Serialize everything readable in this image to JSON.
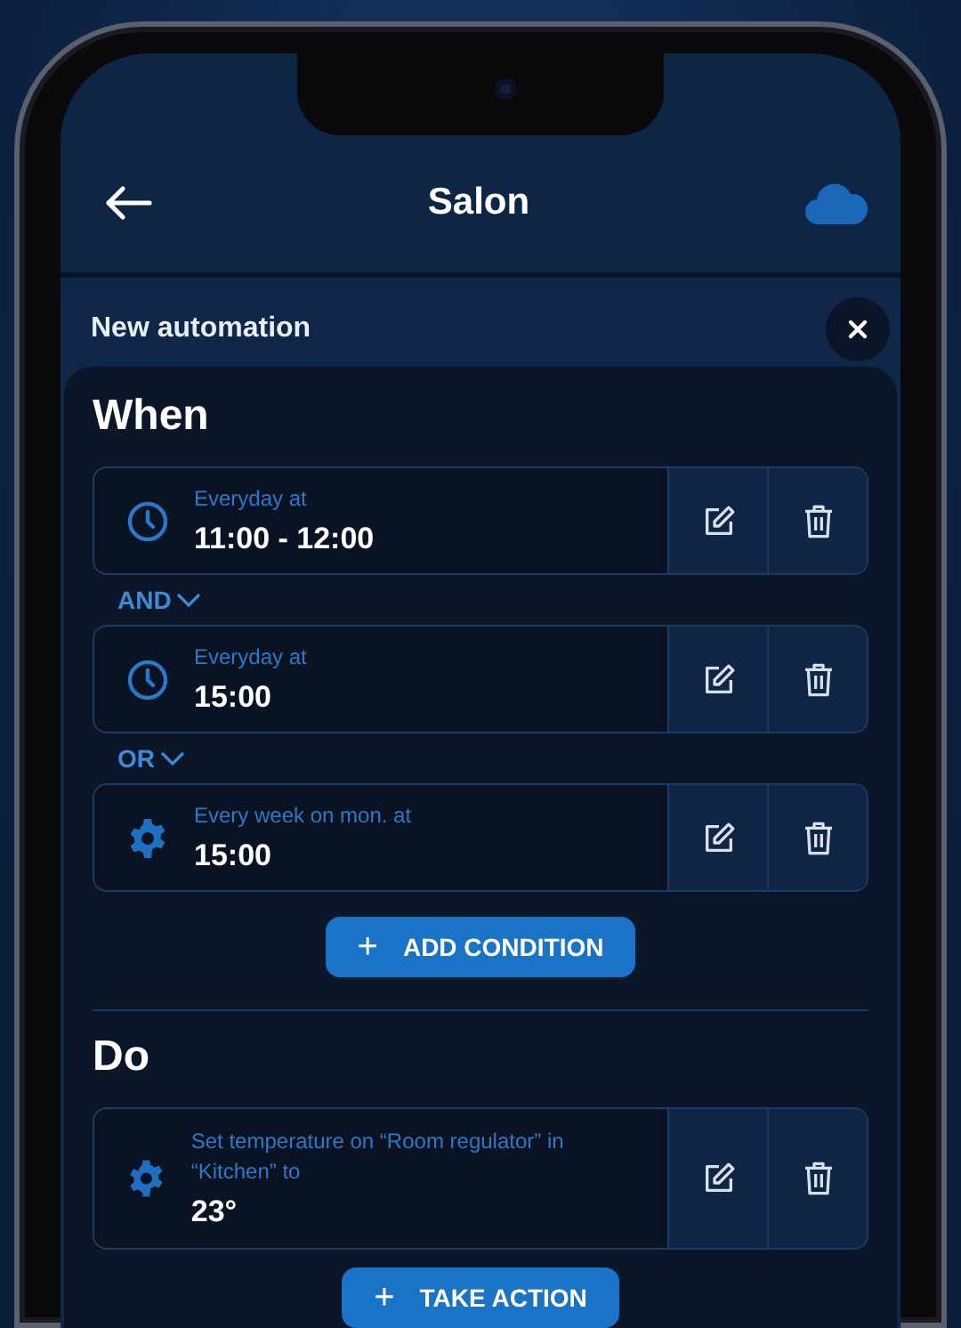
{
  "header": {
    "title": "Salon"
  },
  "dialog": {
    "title": "New automation"
  },
  "when": {
    "heading": "When",
    "items": [
      {
        "kind": "time",
        "caption": "Everyday at",
        "value": "11:00 - 12:00"
      },
      {
        "kind": "connector",
        "label": "AND"
      },
      {
        "kind": "time",
        "caption": "Everyday at",
        "value": "15:00"
      },
      {
        "kind": "connector",
        "label": "OR"
      },
      {
        "kind": "schedule",
        "caption": "Every week on mon. at",
        "value": "15:00"
      }
    ],
    "button": "ADD CONDITION",
    "button_icon": "+"
  },
  "do": {
    "heading": "Do",
    "items": [
      {
        "kind": "schedule",
        "caption": "Set temperature on “Room regulator” in “Kitchen” to",
        "value": "23°"
      }
    ],
    "button": "TAKE ACTION",
    "button_icon": "+"
  }
}
